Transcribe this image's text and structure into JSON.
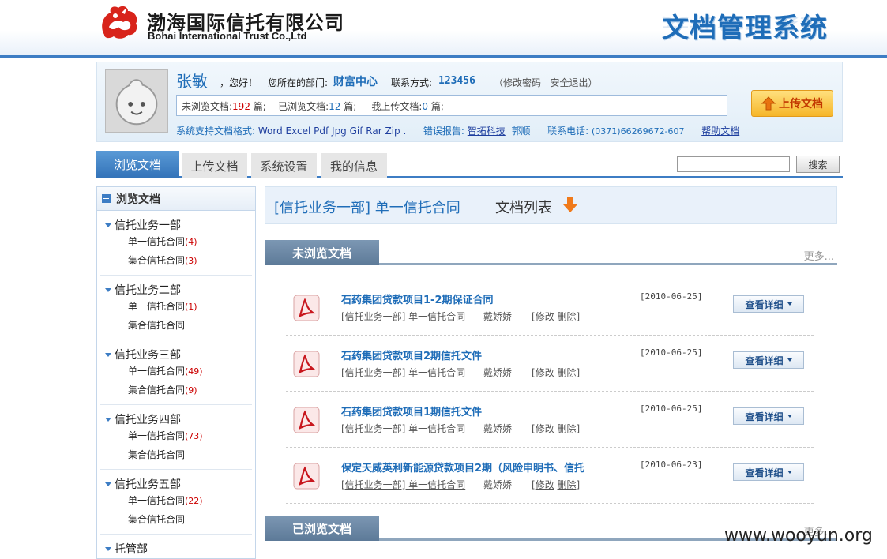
{
  "header": {
    "company_cn": "渤海国际信托有限公司",
    "company_en": "Bohai International Trust Co.,Ltd",
    "system_title": "文档管理系统",
    "brand_color": "#1f6db8"
  },
  "user": {
    "name": "张敏",
    "greeting": "，您好！",
    "dept_label": "您所在的部门:",
    "dept_value": "财富中心",
    "contact_label": "联系方式:",
    "contact_value": "123456",
    "change_password": "修改密码",
    "logout": "安全退出",
    "stats": {
      "unread_label": "未浏览文档:",
      "unread_count": "192",
      "unit": "篇;",
      "read_label": "已浏览文档:",
      "read_count": "12",
      "uploaded_label": "我上传文档:",
      "uploaded_count": "0"
    },
    "formats_label": "系统支持文档格式:",
    "formats": "Word  Excel  Pdf  Jpg  Gif  Rar  Zip .",
    "report_label": "错误报告:",
    "report_link": "智拓科技",
    "report_person": "郭顺",
    "phone_label": "联系电话:",
    "phone_value": "(0371)66269672-607",
    "help_link": "帮助文档",
    "upload_button": "上传文档"
  },
  "tabs": [
    {
      "label": "浏览文档",
      "active": true
    },
    {
      "label": "上传文档",
      "active": false
    },
    {
      "label": "系统设置",
      "active": false
    },
    {
      "label": "我的信息",
      "active": false
    }
  ],
  "search": {
    "placeholder": "",
    "button": "搜索"
  },
  "sidebar": {
    "title": "浏览文档",
    "departments": [
      {
        "name": "信托业务一部",
        "subs": [
          {
            "label": "单一信托合同",
            "count": "(4)"
          },
          {
            "label": "集合信托合同",
            "count": "(3)"
          }
        ]
      },
      {
        "name": "信托业务二部",
        "subs": [
          {
            "label": "单一信托合同",
            "count": "(1)"
          },
          {
            "label": "集合信托合同",
            "count": ""
          }
        ]
      },
      {
        "name": "信托业务三部",
        "subs": [
          {
            "label": "单一信托合同",
            "count": "(49)"
          },
          {
            "label": "集合信托合同",
            "count": "(9)"
          }
        ]
      },
      {
        "name": "信托业务四部",
        "subs": [
          {
            "label": "单一信托合同",
            "count": "(73)"
          },
          {
            "label": "集合信托合同",
            "count": ""
          }
        ]
      },
      {
        "name": "信托业务五部",
        "subs": [
          {
            "label": "单一信托合同",
            "count": "(22)"
          },
          {
            "label": "集合信托合同",
            "count": ""
          }
        ]
      },
      {
        "name": "托管部",
        "subs": []
      }
    ]
  },
  "main": {
    "breadcrumb": "[信托业务一部] 单一信托合同",
    "list_suffix": "文档列表",
    "unread_section": {
      "label": "未浏览文档",
      "more": "更多..."
    },
    "read_section": {
      "label": "已浏览文档",
      "more": "更多..."
    },
    "documents": [
      {
        "title": "石药集团贷款项目1-2期保证合同",
        "category": "[信托业务一部] 单一信托合同",
        "author": "戴娇娇",
        "edit": "修改",
        "delete": "删除",
        "date": "[2010-06-25]",
        "detail": "查看详细"
      },
      {
        "title": "石药集团贷款项目2期信托文件",
        "category": "[信托业务一部] 单一信托合同",
        "author": "戴娇娇",
        "edit": "修改",
        "delete": "删除",
        "date": "[2010-06-25]",
        "detail": "查看详细"
      },
      {
        "title": "石药集团贷款项目1期信托文件",
        "category": "[信托业务一部] 单一信托合同",
        "author": "戴娇娇",
        "edit": "修改",
        "delete": "删除",
        "date": "[2010-06-25]",
        "detail": "查看详细"
      },
      {
        "title": "保定天威英利新能源贷款项目2期（风险申明书、信托",
        "category": "[信托业务一部] 单一信托合同",
        "author": "戴娇娇",
        "edit": "修改",
        "delete": "删除",
        "date": "[2010-06-23]",
        "detail": "查看详细"
      }
    ]
  },
  "watermark": "www.wooyun.org"
}
